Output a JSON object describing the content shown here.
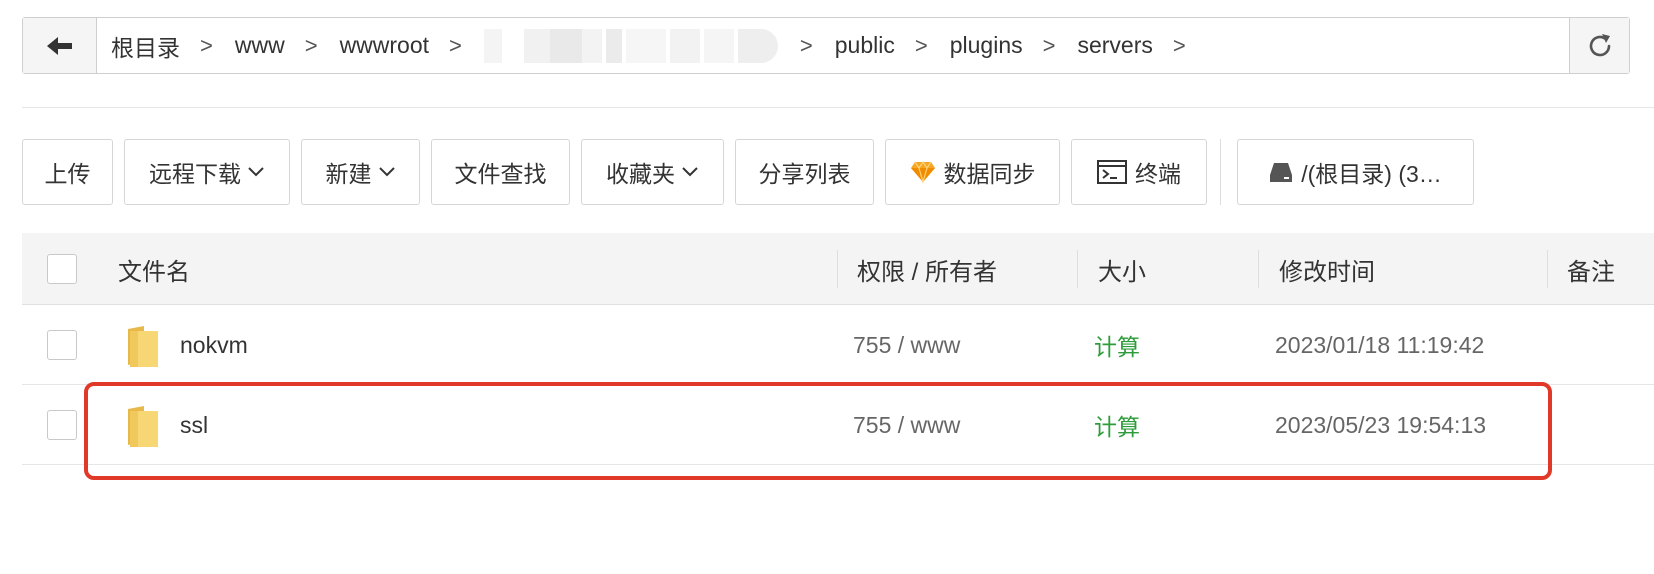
{
  "path": {
    "crumbs": [
      "根目录",
      "www",
      "wwwroot",
      "public",
      "plugins",
      "servers"
    ],
    "separator": ">"
  },
  "toolbar": {
    "upload": "上传",
    "remote_download": "远程下载",
    "new": "新建",
    "file_search": "文件查找",
    "favorites": "收藏夹",
    "share_list": "分享列表",
    "data_sync": "数据同步",
    "terminal": "终端",
    "disk": "/(根目录) (3…"
  },
  "table": {
    "columns": {
      "name": "文件名",
      "permission": "权限 / 所有者",
      "size": "大小",
      "modified": "修改时间",
      "note": "备注"
    },
    "rows": [
      {
        "name": "nokvm",
        "permission": "755 / www",
        "size": "计算",
        "modified": "2023/01/18 11:19:42",
        "note": ""
      },
      {
        "name": "ssl",
        "permission": "755 / www",
        "size": "计算",
        "modified": "2023/05/23 19:54:13",
        "note": ""
      }
    ]
  },
  "colors": {
    "calc_green": "#2e9c3a",
    "highlight_red": "#e0392a",
    "folder_yellow": "#f7d774"
  },
  "icons": [
    "back-arrow-icon",
    "refresh-icon",
    "chevron-down-icon",
    "diamond-icon",
    "terminal-icon",
    "disk-icon",
    "folder-icon"
  ]
}
